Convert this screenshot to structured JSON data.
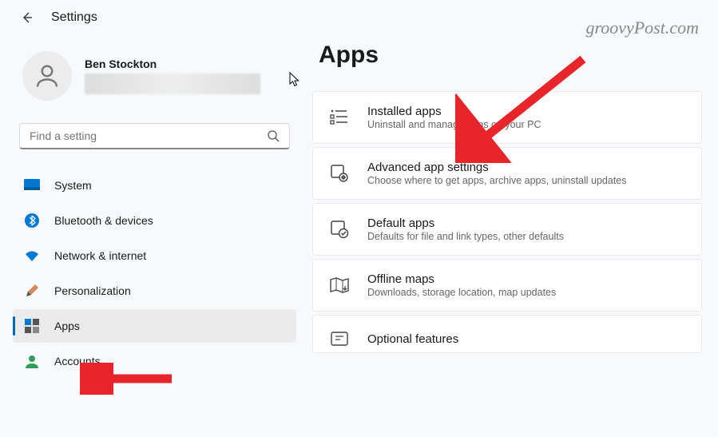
{
  "header": {
    "title": "Settings"
  },
  "profile": {
    "name": "Ben Stockton"
  },
  "search": {
    "placeholder": "Find a setting"
  },
  "sidebar": {
    "items": [
      {
        "label": "System",
        "icon": "system",
        "active": false
      },
      {
        "label": "Bluetooth & devices",
        "icon": "bluetooth",
        "active": false
      },
      {
        "label": "Network & internet",
        "icon": "network",
        "active": false
      },
      {
        "label": "Personalization",
        "icon": "personalization",
        "active": false
      },
      {
        "label": "Apps",
        "icon": "apps",
        "active": true
      },
      {
        "label": "Accounts",
        "icon": "accounts",
        "active": false
      }
    ]
  },
  "page": {
    "title": "Apps"
  },
  "cards": [
    {
      "title": "Installed apps",
      "desc": "Uninstall and manage apps on your PC",
      "icon": "installed"
    },
    {
      "title": "Advanced app settings",
      "desc": "Choose where to get apps, archive apps, uninstall updates",
      "icon": "advanced"
    },
    {
      "title": "Default apps",
      "desc": "Defaults for file and link types, other defaults",
      "icon": "default"
    },
    {
      "title": "Offline maps",
      "desc": "Downloads, storage location, map updates",
      "icon": "maps"
    },
    {
      "title": "Optional features",
      "desc": "",
      "icon": "optional"
    }
  ],
  "watermark": "groovyPost.com"
}
